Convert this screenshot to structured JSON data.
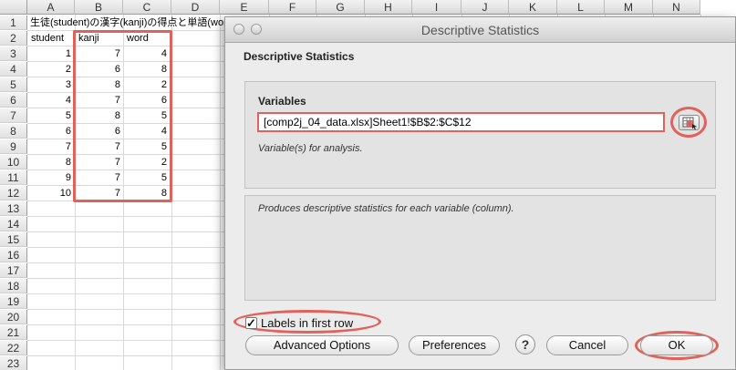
{
  "spreadsheet": {
    "columns": [
      "A",
      "B",
      "C",
      "D",
      "E",
      "F",
      "G",
      "H",
      "I",
      "J",
      "K",
      "L",
      "M",
      "N"
    ],
    "rows": [
      "1",
      "2",
      "3",
      "4",
      "5",
      "6",
      "7",
      "8",
      "9",
      "10",
      "11",
      "12",
      "13",
      "14",
      "15",
      "16",
      "17",
      "18",
      "19",
      "20",
      "21",
      "22",
      "23"
    ],
    "title_cell": "生徒(student)の漢字(kanji)の得点と単語(word)の得点",
    "headers": {
      "a": "student",
      "b": "kanji",
      "c": "word"
    },
    "data": [
      [
        "1",
        "7",
        "4"
      ],
      [
        "2",
        "6",
        "8"
      ],
      [
        "3",
        "8",
        "2"
      ],
      [
        "4",
        "7",
        "6"
      ],
      [
        "5",
        "8",
        "5"
      ],
      [
        "6",
        "6",
        "4"
      ],
      [
        "7",
        "7",
        "5"
      ],
      [
        "8",
        "7",
        "2"
      ],
      [
        "9",
        "7",
        "5"
      ],
      [
        "10",
        "7",
        "8"
      ]
    ],
    "highlight_color": "#e0625a"
  },
  "dialog": {
    "window_title": "Descriptive Statistics",
    "heading": "Descriptive Statistics",
    "variables_label": "Variables",
    "variables_value": "[comp2j_04_data.xlsx]Sheet1!$B$2:$C$12",
    "variables_hint": "Variable(s) for analysis.",
    "description": "Produces descriptive statistics for each variable (column).",
    "labels_checkbox": {
      "label": "Labels in first row",
      "checked": true,
      "mark": "✓"
    },
    "buttons": {
      "advanced": "Advanced Options",
      "preferences": "Preferences",
      "help": "?",
      "cancel": "Cancel",
      "ok": "OK"
    },
    "range_picker_icon": "range-select-icon"
  }
}
